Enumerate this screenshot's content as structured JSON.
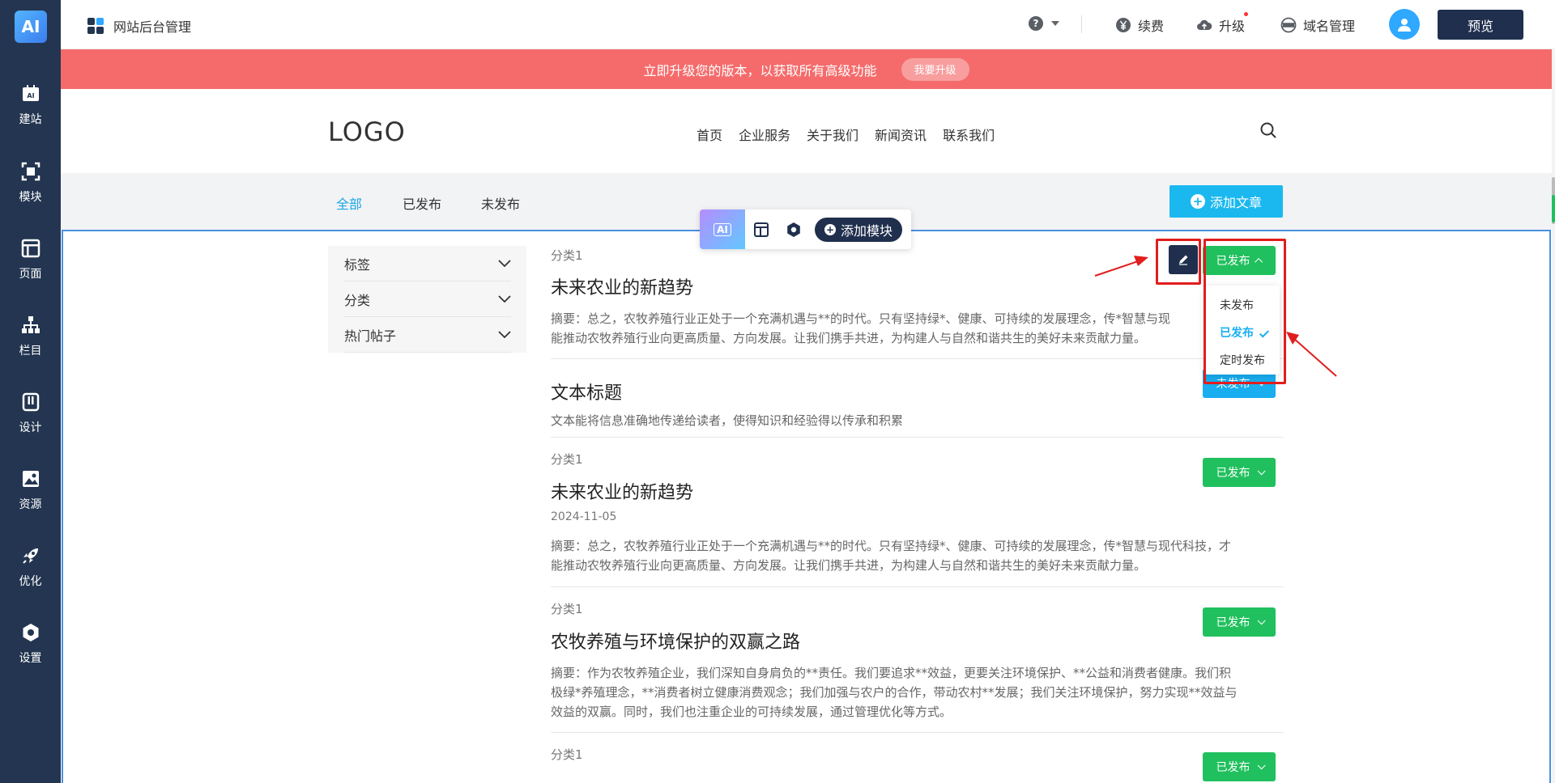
{
  "sidebar": {
    "logo": "AI",
    "items": [
      {
        "label": "建站",
        "icon": "ai-build-icon"
      },
      {
        "label": "模块",
        "icon": "module-icon"
      },
      {
        "label": "页面",
        "icon": "page-icon"
      },
      {
        "label": "栏目",
        "icon": "sitemap-icon"
      },
      {
        "label": "设计",
        "icon": "design-icon"
      },
      {
        "label": "资源",
        "icon": "image-icon"
      },
      {
        "label": "优化",
        "icon": "rocket-icon"
      },
      {
        "label": "设置",
        "icon": "settings-icon"
      }
    ]
  },
  "topbar": {
    "title": "网站后台管理",
    "help": "?",
    "renew": "续费",
    "upgrade": "升级",
    "domain": "域名管理",
    "preview": "预览"
  },
  "banner": {
    "text": "立即升级您的版本，以获取所有高级功能",
    "button": "我要升级"
  },
  "site": {
    "logo": "LOGO",
    "nav": [
      "首页",
      "企业服务",
      "关于我们",
      "新闻资讯",
      "联系我们"
    ]
  },
  "filter_tabs": [
    "全部",
    "已发布",
    "未发布"
  ],
  "add_article": "添加文章",
  "module_toolbar": {
    "ai": "AI",
    "add_module": "添加模块"
  },
  "filters": [
    "标签",
    "分类",
    "热门帖子"
  ],
  "articles": [
    {
      "category": "分类1",
      "title": "未来农业的新趋势",
      "summary_1": "摘要：总之，农牧养殖行业正处于一个充满机遇与**的时代。只有坚持绿*、健康、可持续的发展理念，传*智慧与现",
      "summary_2": "能推动农牧养殖行业向更高质量、方向发展。让我们携手共进，为构建人与自然和谐共生的美好未来贡献力量。",
      "status": "已发布"
    },
    {
      "title": "文本标题",
      "summary_1": "文本能将信息准确地传递给读者，使得知识和经验得以传承和积累",
      "status": "未发布"
    },
    {
      "category": "分类1",
      "title": "未来农业的新趋势",
      "date": "2024-11-05",
      "summary_1": "摘要：总之，农牧养殖行业正处于一个充满机遇与**的时代。只有坚持绿*、健康、可持续的发展理念，传*智慧与现代科技，才",
      "summary_2": "能推动农牧养殖行业向更高质量、方向发展。让我们携手共进，为构建人与自然和谐共生的美好未来贡献力量。",
      "status": "已发布"
    },
    {
      "category": "分类1",
      "title": "农牧养殖与环境保护的双赢之路",
      "summary_1": "摘要：作为农牧养殖企业，我们深知自身肩负的**责任。我们要追求**效益，更要关注环境保护、**公益和消费者健康。我们积",
      "summary_2": "极绿*养殖理念，**消费者树立健康消费观念；我们加强与农户的合作，带动农村**发展；我们关注环境保护，努力实现**效益与",
      "summary_3": "效益的双赢。同时，我们也注重企业的可持续发展，通过管理优化等方式。",
      "status": "已发布"
    },
    {
      "category": "分类1",
      "status": "已发布"
    }
  ],
  "status_dropdown": {
    "options": [
      "未发布",
      "已发布",
      "定时发布"
    ],
    "selected": "已发布"
  },
  "colors": {
    "sidebar": "#233550",
    "banner": "#f56b6b",
    "accent": "#1ab8ef",
    "published": "#21c05e",
    "annotation": "#e21d1d"
  }
}
